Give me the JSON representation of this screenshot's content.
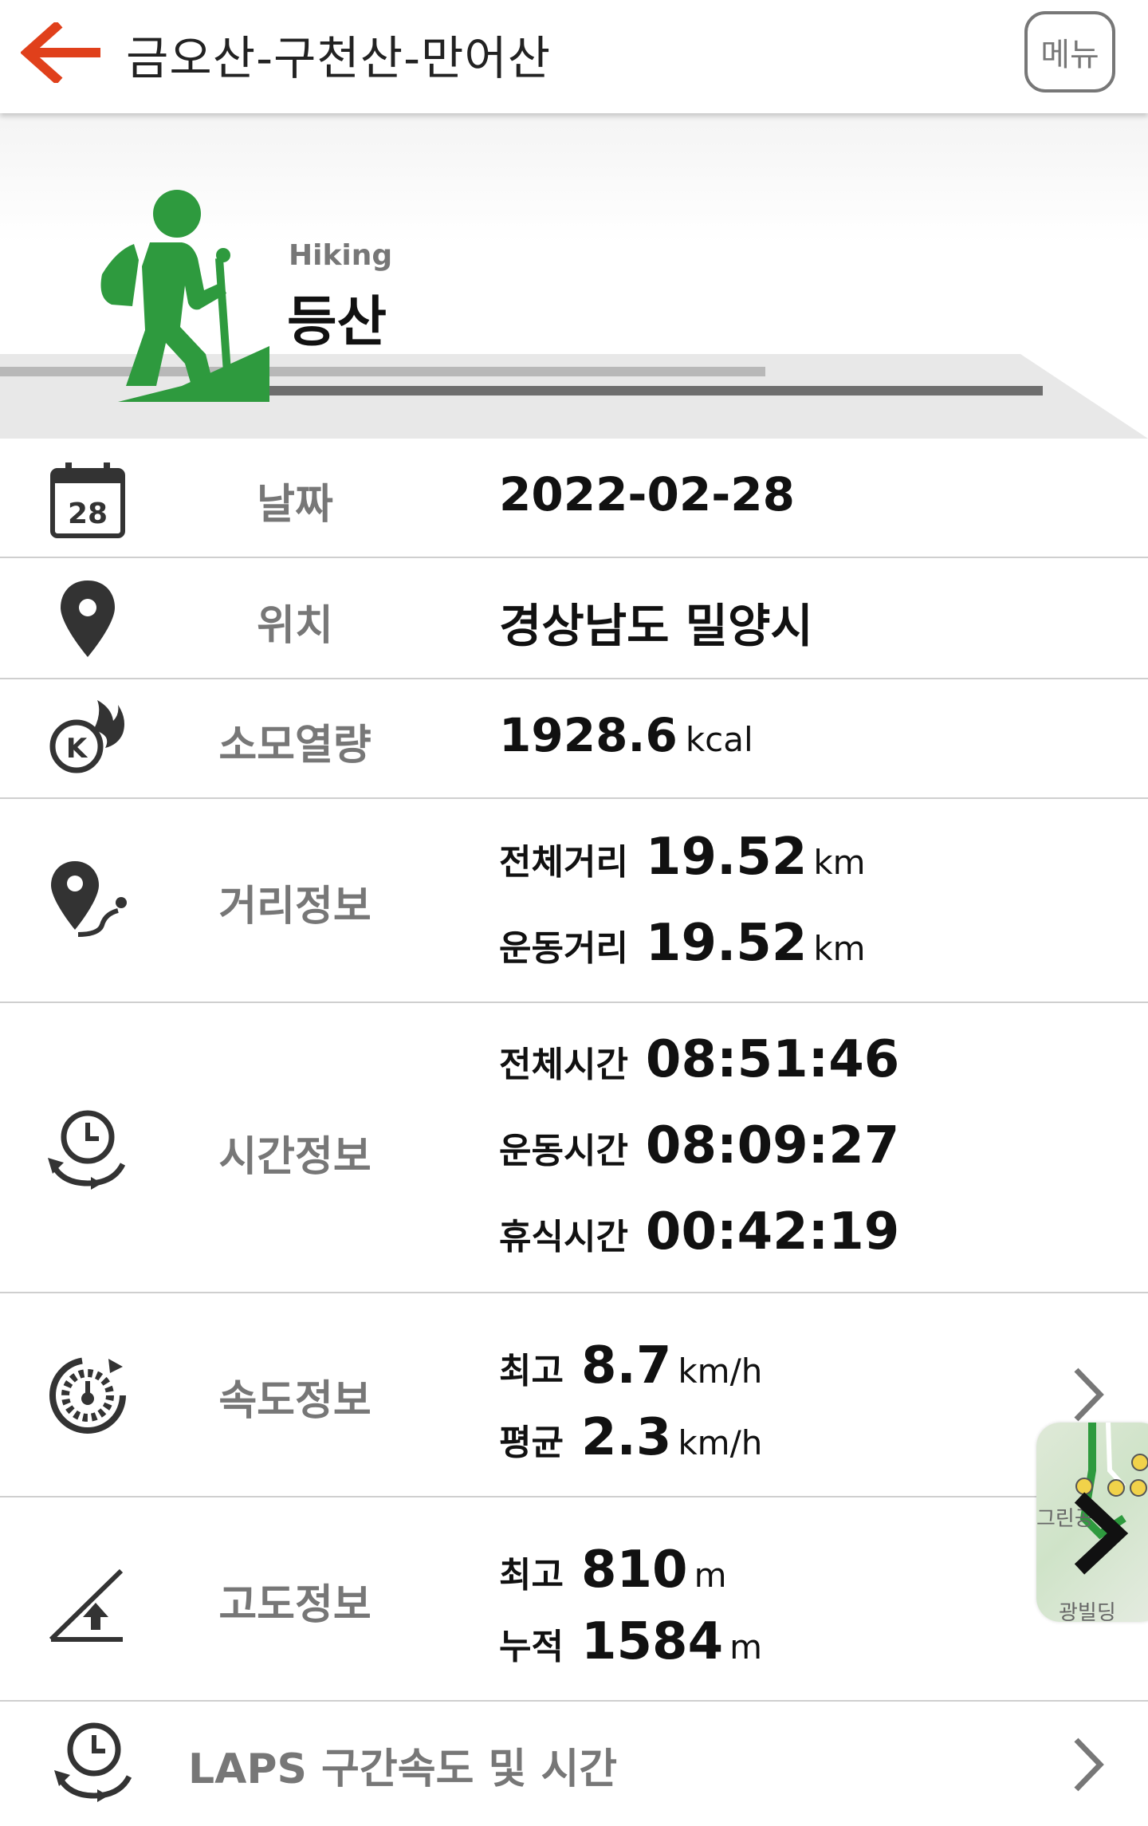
{
  "header": {
    "title": "금오산-구천산-만어산",
    "menu_label": "메뉴"
  },
  "activity": {
    "name_en": "Hiking",
    "name_ko": "등산"
  },
  "rows": {
    "date": {
      "label": "날짜",
      "value": "2022-02-28",
      "icon_day": "28"
    },
    "location": {
      "label": "위치",
      "value": "경상남도 밀양시"
    },
    "calories": {
      "label": "소모열량",
      "value": "1928.6",
      "unit": "kcal"
    },
    "distance": {
      "label": "거리정보",
      "total_label": "전체거리",
      "total_value": "19.52",
      "total_unit": "km",
      "moving_label": "운동거리",
      "moving_value": "19.52",
      "moving_unit": "km"
    },
    "time": {
      "label": "시간정보",
      "total_label": "전체시간",
      "total_value": "08:51:46",
      "moving_label": "운동시간",
      "moving_value": "08:09:27",
      "rest_label": "휴식시간",
      "rest_value": "00:42:19"
    },
    "speed": {
      "label": "속도정보",
      "max_label": "최고",
      "max_value": "8.7",
      "max_unit": "km/h",
      "avg_label": "평균",
      "avg_value": "2.3",
      "avg_unit": "km/h"
    },
    "altitude": {
      "label": "고도정보",
      "max_label": "최고",
      "max_value": "810",
      "max_unit": "m",
      "cum_label": "누적",
      "cum_value": "1584",
      "cum_unit": "m"
    },
    "laps": {
      "label": "LAPS 구간속도 및 시간"
    }
  },
  "map_thumb": {
    "text_top": "그린공",
    "text_bottom": "광빌딩"
  },
  "colors": {
    "accent_orange": "#e0401b",
    "hiker_green": "#2e9a3e",
    "label_gray": "#777777"
  },
  "icons": [
    "back-arrow-icon",
    "hiker-icon",
    "calendar-icon",
    "location-pin-icon",
    "calorie-flame-icon",
    "distance-route-icon",
    "time-clock-icon",
    "speedometer-icon",
    "altitude-icon",
    "laps-clock-icon",
    "chevron-right-icon"
  ]
}
